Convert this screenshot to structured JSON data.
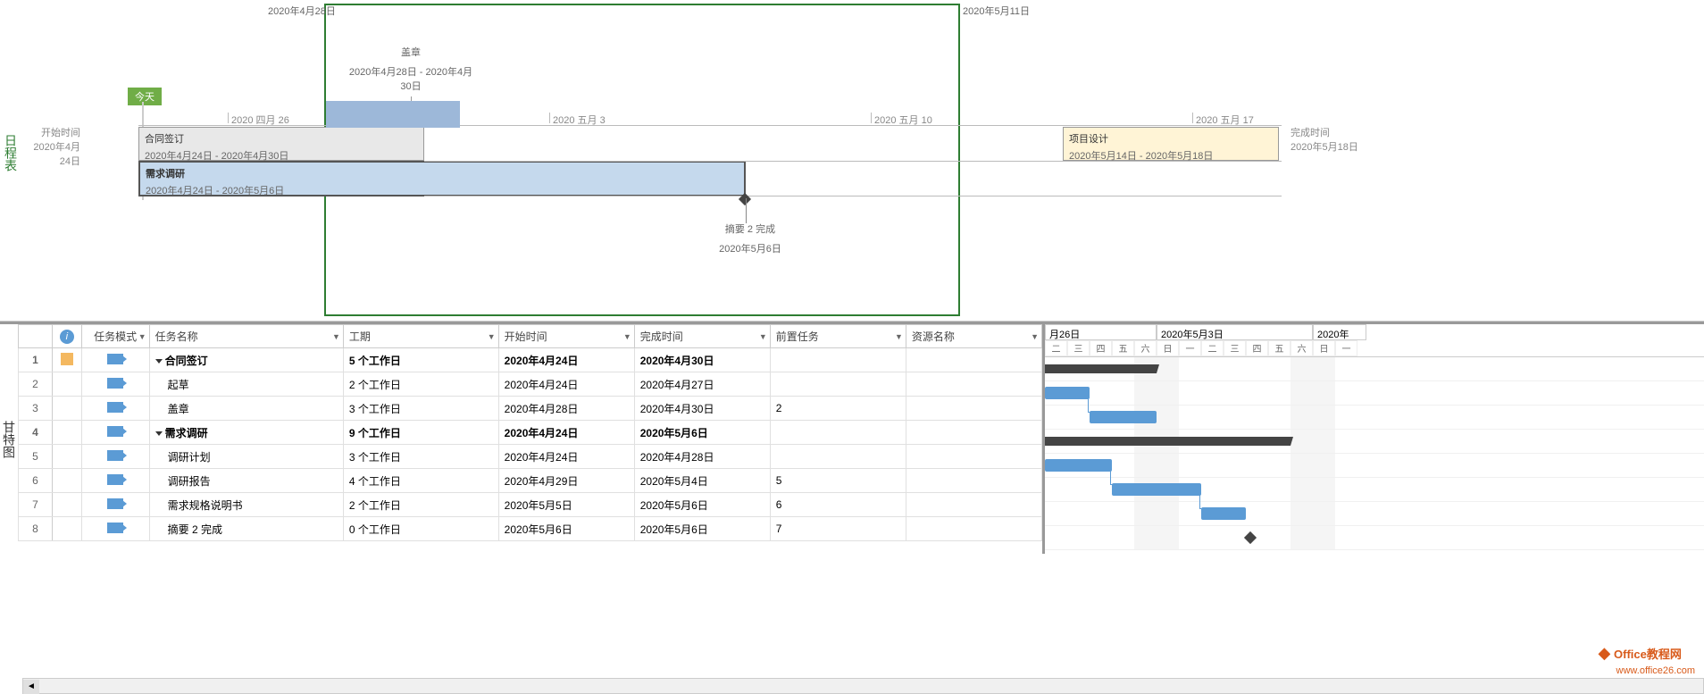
{
  "timeline": {
    "label": "日程表",
    "today": "今天",
    "start_label": "开始时间",
    "start_date": "2020年4月24日",
    "end_label": "完成时间",
    "end_date": "2020年5月18日",
    "markers": {
      "top_left": "2020年4月28日",
      "top_right": "2020年5月11日"
    },
    "ticks": [
      {
        "label": "2020 四月 26"
      },
      {
        "label": "2020 五月 3"
      },
      {
        "label": "2020 五月 10"
      },
      {
        "label": "2020 五月 17"
      }
    ],
    "callout": {
      "title": "盖章",
      "dates": "2020年4月28日 - 2020年4月30日"
    },
    "bars": [
      {
        "name": "合同签订",
        "dates": "2020年4月24日 - 2020年4月30日"
      },
      {
        "name": "需求调研",
        "dates": "2020年4月24日 - 2020年5月6日"
      },
      {
        "name": "项目设计",
        "dates": "2020年5月14日 - 2020年5月18日"
      }
    ],
    "milestone": {
      "name": "摘要 2 完成",
      "date": "2020年5月6日"
    }
  },
  "table": {
    "label": "甘特图",
    "columns": {
      "info": "",
      "mode": "任务模式",
      "name": "任务名称",
      "duration": "工期",
      "start": "开始时间",
      "finish": "完成时间",
      "pred": "前置任务",
      "resource": "资源名称"
    },
    "rows": [
      {
        "n": 1,
        "bold": true,
        "outline": true,
        "name": "合同签订",
        "dur": "5 个工作日",
        "start": "2020年4月24日",
        "fin": "2020年4月30日",
        "pred": "",
        "note": true
      },
      {
        "n": 2,
        "indent": 1,
        "name": "起草",
        "dur": "2 个工作日",
        "start": "2020年4月24日",
        "fin": "2020年4月27日",
        "pred": ""
      },
      {
        "n": 3,
        "indent": 1,
        "name": "盖章",
        "dur": "3 个工作日",
        "start": "2020年4月28日",
        "fin": "2020年4月30日",
        "pred": "2"
      },
      {
        "n": 4,
        "bold": true,
        "outline": true,
        "name": "需求调研",
        "dur": "9 个工作日",
        "start": "2020年4月24日",
        "fin": "2020年5月6日",
        "pred": ""
      },
      {
        "n": 5,
        "indent": 1,
        "name": "调研计划",
        "dur": "3 个工作日",
        "start": "2020年4月24日",
        "fin": "2020年4月28日",
        "pred": ""
      },
      {
        "n": 6,
        "indent": 1,
        "name": "调研报告",
        "dur": "4 个工作日",
        "start": "2020年4月29日",
        "fin": "2020年5月4日",
        "pred": "5"
      },
      {
        "n": 7,
        "indent": 1,
        "name": "需求规格说明书",
        "dur": "2 个工作日",
        "start": "2020年5月5日",
        "fin": "2020年5月6日",
        "pred": "6"
      },
      {
        "n": 8,
        "indent": 1,
        "name": "摘要 2 完成",
        "dur": "0 个工作日",
        "start": "2020年5月6日",
        "fin": "2020年5月6日",
        "pred": "7"
      }
    ]
  },
  "gantt": {
    "weeks": [
      "月26日",
      "2020年5月3日",
      "2020年"
    ],
    "days": [
      "二",
      "三",
      "四",
      "五",
      "六",
      "日",
      "一",
      "二",
      "三",
      "四",
      "五",
      "六",
      "日",
      "一"
    ]
  },
  "watermark": {
    "l1": "Office教程网",
    "l2": "www.office26.com"
  },
  "chart_data": {
    "type": "gantt",
    "tasks": [
      {
        "id": 1,
        "name": "合同签订",
        "start": "2020-04-24",
        "end": "2020-04-30",
        "duration_days": 5,
        "summary": true
      },
      {
        "id": 2,
        "name": "起草",
        "start": "2020-04-24",
        "end": "2020-04-27",
        "duration_days": 2,
        "parent": 1
      },
      {
        "id": 3,
        "name": "盖章",
        "start": "2020-04-28",
        "end": "2020-04-30",
        "duration_days": 3,
        "parent": 1,
        "predecessor": 2
      },
      {
        "id": 4,
        "name": "需求调研",
        "start": "2020-04-24",
        "end": "2020-05-06",
        "duration_days": 9,
        "summary": true
      },
      {
        "id": 5,
        "name": "调研计划",
        "start": "2020-04-24",
        "end": "2020-04-28",
        "duration_days": 3,
        "parent": 4
      },
      {
        "id": 6,
        "name": "调研报告",
        "start": "2020-04-29",
        "end": "2020-05-04",
        "duration_days": 4,
        "parent": 4,
        "predecessor": 5
      },
      {
        "id": 7,
        "name": "需求规格说明书",
        "start": "2020-05-05",
        "end": "2020-05-06",
        "duration_days": 2,
        "parent": 4,
        "predecessor": 6
      },
      {
        "id": 8,
        "name": "摘要 2 完成",
        "start": "2020-05-06",
        "end": "2020-05-06",
        "duration_days": 0,
        "parent": 4,
        "predecessor": 7,
        "milestone": true
      }
    ],
    "timeline_range": {
      "start": "2020-04-24",
      "end": "2020-05-18"
    }
  }
}
